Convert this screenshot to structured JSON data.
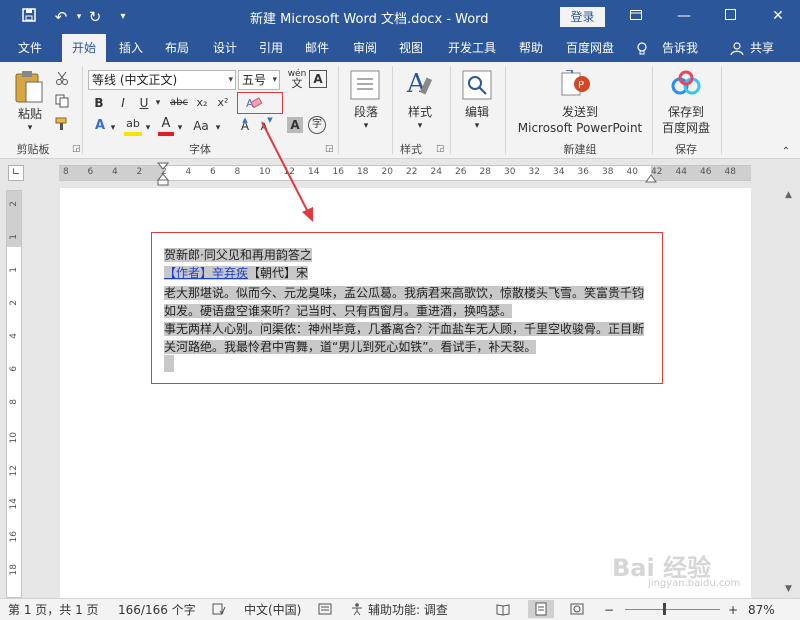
{
  "titlebar": {
    "title": "新建 Microsoft Word 文档.docx  -  Word",
    "login_label": "登录"
  },
  "tabs": [
    {
      "label": "文件"
    },
    {
      "label": "开始"
    },
    {
      "label": "插入"
    },
    {
      "label": "布局"
    },
    {
      "label": "设计"
    },
    {
      "label": "引用"
    },
    {
      "label": "邮件"
    },
    {
      "label": "审阅"
    },
    {
      "label": "视图"
    },
    {
      "label": "开发工具"
    },
    {
      "label": "帮助"
    },
    {
      "label": "百度网盘"
    }
  ],
  "tell_me": "告诉我",
  "share": "共享",
  "ribbon": {
    "clipboard": {
      "paste": "粘贴",
      "group": "剪贴板"
    },
    "font": {
      "font_name": "等线 (中文正文)",
      "font_size": "五号",
      "wen_glyph": "wén",
      "bold": "B",
      "italic": "I",
      "underline": "U",
      "strike": "abc",
      "subscript": "x₂",
      "superscript": "x²",
      "effects": "A",
      "highlight": "ab",
      "font_color": "A",
      "change_case": "Aa",
      "grow": "A",
      "shrink": "A",
      "char_shade": "A",
      "enclose": "字",
      "border_a": "A",
      "group": "字体"
    },
    "paragraph": {
      "label": "段落"
    },
    "styles": {
      "label": "样式",
      "group": "样式"
    },
    "editing": {
      "label": "编辑"
    },
    "newgroup": {
      "line1": "发送到",
      "line2": "Microsoft PowerPoint",
      "group": "新建组"
    },
    "save": {
      "line1": "保存到",
      "line2": "百度网盘",
      "group": "保存"
    }
  },
  "ruler": {
    "numbers": [
      "8",
      "6",
      "4",
      "2",
      "2",
      "4",
      "6",
      "8",
      "10",
      "12",
      "14",
      "16",
      "18",
      "20",
      "22",
      "24",
      "26",
      "28",
      "30",
      "32",
      "34",
      "36",
      "38",
      "40",
      "42",
      "44",
      "46",
      "48"
    ],
    "vnumbers": [
      "2",
      "1",
      "1",
      "2",
      "4",
      "6",
      "8",
      "10",
      "12",
      "14",
      "16",
      "18"
    ]
  },
  "document": {
    "lines": [
      {
        "text": "贺新郎·同父见和再用韵答之"
      },
      {
        "link": "【作者】辛弃疾",
        "rest": "【朝代】宋"
      },
      {
        "text": "老大那堪说。似而今、元龙臭味，孟公瓜葛。我病君来高歌饮，惊散楼头飞雪。笑富贵千钧"
      },
      {
        "text": "如发。硬语盘空谁来听？记当时、只有西窗月。重进酒，换鸣瑟。"
      },
      {
        "text": "事无两样人心别。问渠侬：神州毕竟，几番离合？汗血盐车无人顾，千里空收骏骨。正目断"
      },
      {
        "text": "关河路绝。我最怜君中宵舞，道“男儿到死心如铁”。看试手，补天裂。"
      }
    ]
  },
  "status": {
    "page": "第 1 页，共 1 页",
    "words": "166/166 个字",
    "lang": "中文(中国)",
    "accessibility": "辅助功能: 调查",
    "zoom": "87%",
    "zoom_minus": "−",
    "zoom_plus": "+"
  },
  "watermark": {
    "main": "Bai 经验",
    "sub": "jingyan.baidu.com"
  },
  "colors": {
    "accent": "#2b579a",
    "annotation": "#e0393e",
    "selection": "#c8c8c8"
  }
}
